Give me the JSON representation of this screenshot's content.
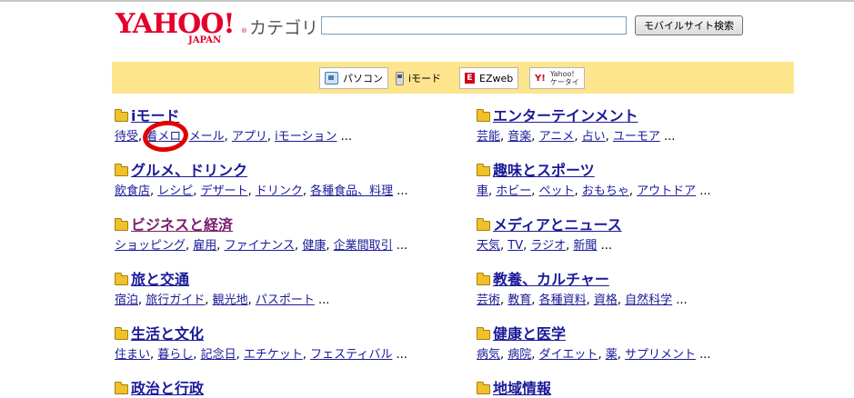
{
  "header": {
    "logo_text": "YAHOO!",
    "logo_sub": "JAPAN",
    "logo_reg": "®",
    "category_label": "カテゴリ",
    "search_value": "",
    "search_button": "モバイルサイト検索"
  },
  "device_tabs": [
    {
      "label": "パソコン",
      "icon": "pc-icon"
    },
    {
      "label": "iモード",
      "icon": "phone-icon"
    },
    {
      "label": "EZweb",
      "icon": "ezweb-icon"
    },
    {
      "label": "Yahoo!ケータイ",
      "label_top": "Yahoo!",
      "label_bottom": "ケータイ",
      "icon": "yahoo-keitai-icon"
    }
  ],
  "categories": [
    {
      "title": "iモード",
      "subs": [
        "待受",
        "着メロ",
        "メール",
        "アプリ",
        "iモーション"
      ],
      "more": "..."
    },
    {
      "title": "エンターテインメント",
      "subs": [
        "芸能",
        "音楽",
        "アニメ",
        "占い",
        "ユーモア"
      ],
      "more": "..."
    },
    {
      "title": "グルメ、ドリンク",
      "subs": [
        "飲食店",
        "レシピ",
        "デザート",
        "ドリンク",
        "各種食品、料理"
      ],
      "more": "..."
    },
    {
      "title": "趣味とスポーツ",
      "subs": [
        "車",
        "ホビー",
        "ペット",
        "おもちゃ",
        "アウトドア"
      ],
      "more": "..."
    },
    {
      "title": "ビジネスと経済",
      "subs": [
        "ショッピング",
        "雇用",
        "ファイナンス",
        "健康",
        "企業間取引"
      ],
      "more": "..."
    },
    {
      "title": "メディアとニュース",
      "subs": [
        "天気",
        "TV",
        "ラジオ",
        "新聞"
      ],
      "more": "..."
    },
    {
      "title": "旅と交通",
      "subs": [
        "宿泊",
        "旅行ガイド",
        "観光地",
        "パスポート"
      ],
      "more": "..."
    },
    {
      "title": "教養、カルチャー",
      "subs": [
        "芸術",
        "教育",
        "各種資料",
        "資格",
        "自然科学"
      ],
      "more": "..."
    },
    {
      "title": "生活と文化",
      "subs": [
        "住まい",
        "暮らし",
        "記念日",
        "エチケット",
        "フェスティバル"
      ],
      "more": "..."
    },
    {
      "title": "健康と医学",
      "subs": [
        "病気",
        "病院",
        "ダイエット",
        "薬",
        "サプリメント"
      ],
      "more": "..."
    },
    {
      "title": "政治と行政",
      "subs": [],
      "more": ""
    },
    {
      "title": "地域情報",
      "subs": [],
      "more": ""
    }
  ],
  "colors": {
    "link": "#1a1a99",
    "visited": "#7a1f6e",
    "band": "#fde58e",
    "brand_red": "#e3002b",
    "annotation": "#e00000"
  }
}
